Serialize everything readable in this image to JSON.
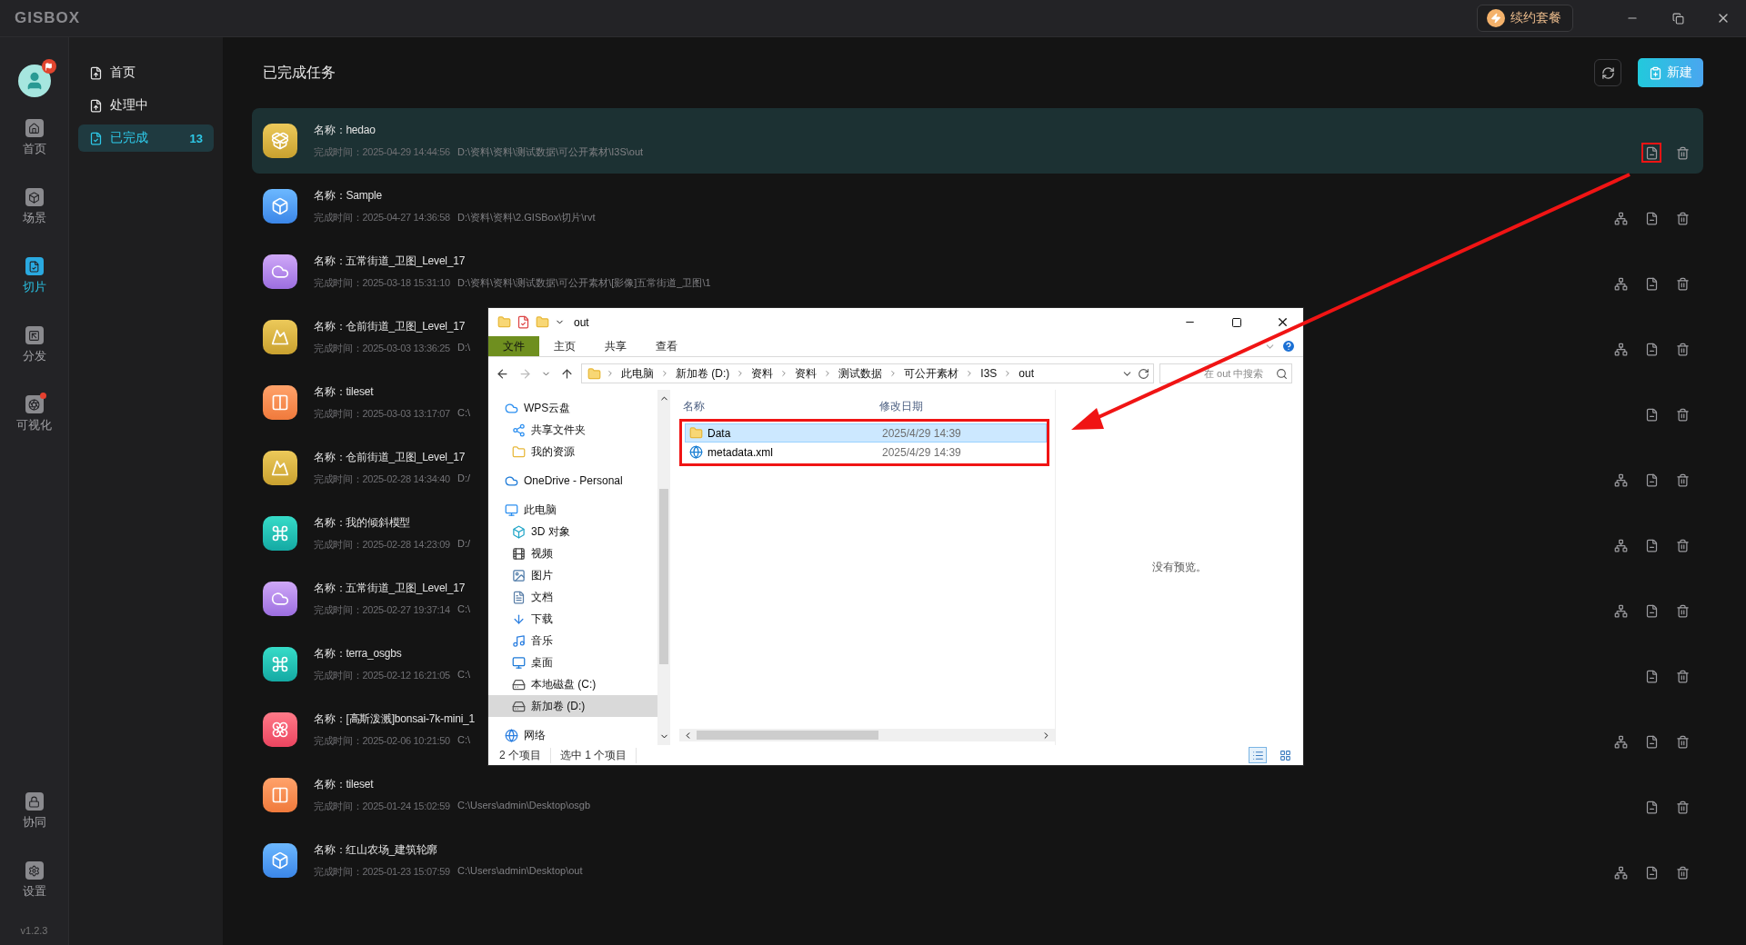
{
  "app": {
    "logo": "GISBOX",
    "plan_button": "续约套餐",
    "version": "v1.2.3"
  },
  "rail": [
    {
      "label": "首页",
      "kind": "home",
      "selected": false,
      "alert": false
    },
    {
      "label": "场景",
      "kind": "scene",
      "selected": false,
      "alert": false
    },
    {
      "label": "切片",
      "kind": "tile",
      "selected": true,
      "alert": false
    },
    {
      "label": "分发",
      "kind": "publish",
      "selected": false,
      "alert": false
    },
    {
      "label": "可视化",
      "kind": "visual",
      "selected": false,
      "alert": true
    }
  ],
  "rail_bottom": [
    {
      "label": "协同",
      "kind": "team"
    },
    {
      "label": "设置",
      "kind": "settings"
    }
  ],
  "subnav": [
    {
      "label": "首页",
      "kind": "upload",
      "selected": false
    },
    {
      "label": "处理中",
      "kind": "upload",
      "selected": false
    },
    {
      "label": "已完成",
      "kind": "done",
      "selected": true,
      "count": "13"
    }
  ],
  "page": {
    "title": "已完成任务",
    "new_button": "新建"
  },
  "tasks": [
    {
      "kind": "i3s",
      "name_label": "名称：",
      "name": "hedao",
      "time_label": "完成时间：",
      "time": "2025-04-29 14:44:56",
      "path": "D:\\资料\\资料\\测试数据\\可公开素材\\I3S\\out",
      "selected": true,
      "actions": [
        {
          "kind": "folder",
          "framed": true
        },
        {
          "kind": "delete",
          "framed": false
        }
      ]
    },
    {
      "kind": "model",
      "name_label": "名称：",
      "name": "Sample",
      "time_label": "完成时间：",
      "time": "2025-04-27 14:36:58",
      "path": "D:\\资料\\资料\\2.GISBox\\切片\\rvt",
      "selected": false,
      "actions": [
        {
          "kind": "publish",
          "framed": false
        },
        {
          "kind": "folder",
          "framed": false
        },
        {
          "kind": "delete",
          "framed": false
        }
      ]
    },
    {
      "kind": "imagery",
      "name_label": "名称：",
      "name": "五常街道_卫图_Level_17",
      "time_label": "完成时间：",
      "time": "2025-03-18 15:31:10",
      "path": "D:\\资料\\资料\\测试数据\\可公开素材\\[影像]五常街道_卫图\\1",
      "selected": false,
      "actions": [
        {
          "kind": "publish",
          "framed": false
        },
        {
          "kind": "folder",
          "framed": false
        },
        {
          "kind": "delete",
          "framed": false
        }
      ]
    },
    {
      "kind": "terrain",
      "name_label": "名称：",
      "name": "仓前街道_卫图_Level_17",
      "time_label": "完成时间：",
      "time": "2025-03-03 13:36:25",
      "path": "D:\\",
      "selected": false,
      "actions": [
        {
          "kind": "publish",
          "framed": false
        },
        {
          "kind": "folder",
          "framed": false
        },
        {
          "kind": "delete",
          "framed": false
        }
      ]
    },
    {
      "kind": "tileset",
      "name_label": "名称：",
      "name": "tileset",
      "time_label": "完成时间：",
      "time": "2025-03-03 13:17:07",
      "path": "C:\\",
      "selected": false,
      "actions": [
        {
          "kind": "folder",
          "framed": false
        },
        {
          "kind": "delete",
          "framed": false
        }
      ]
    },
    {
      "kind": "terrain",
      "name_label": "名称：",
      "name": "仓前街道_卫图_Level_17",
      "time_label": "完成时间：",
      "time": "2025-02-28 14:34:40",
      "path": "D:/",
      "selected": false,
      "actions": [
        {
          "kind": "publish",
          "framed": false
        },
        {
          "kind": "folder",
          "framed": false
        },
        {
          "kind": "delete",
          "framed": false
        }
      ]
    },
    {
      "kind": "osgb",
      "name_label": "名称：",
      "name": "我的倾斜模型",
      "time_label": "完成时间：",
      "time": "2025-02-28 14:23:09",
      "path": "D:/",
      "selected": false,
      "actions": [
        {
          "kind": "publish",
          "framed": false
        },
        {
          "kind": "folder",
          "framed": false
        },
        {
          "kind": "delete",
          "framed": false
        }
      ]
    },
    {
      "kind": "imagery",
      "name_label": "名称：",
      "name": "五常街道_卫图_Level_17",
      "time_label": "完成时间：",
      "time": "2025-02-27 19:37:14",
      "path": "C:\\",
      "selected": false,
      "actions": [
        {
          "kind": "publish",
          "framed": false
        },
        {
          "kind": "folder",
          "framed": false
        },
        {
          "kind": "delete",
          "framed": false
        }
      ]
    },
    {
      "kind": "osgb",
      "name_label": "名称：",
      "name": "terra_osgbs",
      "time_label": "完成时间：",
      "time": "2025-02-12 16:21:05",
      "path": "C:\\",
      "selected": false,
      "actions": [
        {
          "kind": "folder",
          "framed": false
        },
        {
          "kind": "delete",
          "framed": false
        }
      ]
    },
    {
      "kind": "splat",
      "name_label": "名称：",
      "name": "[高斯泼溅]bonsai-7k-mini_1",
      "time_label": "完成时间：",
      "time": "2025-02-06 10:21:50",
      "path": "C:\\",
      "selected": false,
      "actions": [
        {
          "kind": "publish",
          "framed": false
        },
        {
          "kind": "folder",
          "framed": false
        },
        {
          "kind": "delete",
          "framed": false
        }
      ]
    },
    {
      "kind": "tileset",
      "name_label": "名称：",
      "name": "tileset",
      "time_label": "完成时间：",
      "time": "2025-01-24 15:02:59",
      "path": "C:\\Users\\admin\\Desktop\\osgb",
      "selected": false,
      "actions": [
        {
          "kind": "folder",
          "framed": false
        },
        {
          "kind": "delete",
          "framed": false
        }
      ]
    },
    {
      "kind": "model",
      "name_label": "名称：",
      "name": "红山农场_建筑轮廓",
      "time_label": "完成时间：",
      "time": "2025-01-23 15:07:59",
      "path": "C:\\Users\\admin\\Desktop\\out",
      "selected": false,
      "actions": [
        {
          "kind": "publish",
          "framed": false
        },
        {
          "kind": "folder",
          "framed": false
        },
        {
          "kind": "delete",
          "framed": false
        }
      ]
    }
  ],
  "explorer": {
    "title": "out",
    "ribbon_tabs": [
      {
        "label": "文件",
        "selected": true
      },
      {
        "label": "主页",
        "selected": false
      },
      {
        "label": "共享",
        "selected": false
      },
      {
        "label": "查看",
        "selected": false
      }
    ],
    "breadcrumb": [
      "此电脑",
      "新加卷 (D:)",
      "资料",
      "资料",
      "测试数据",
      "可公开素材",
      "I3S",
      "out"
    ],
    "search": {
      "placeholder": "在 out 中搜索"
    },
    "nav": [
      {
        "label": "WPS云盘",
        "kind": "cloud",
        "selected": false,
        "children": [
          {
            "label": "共享文件夹",
            "kind": "share",
            "selected": false
          },
          {
            "label": "我的资源",
            "kind": "folder",
            "selected": false
          }
        ]
      },
      {
        "label": "OneDrive - Personal",
        "kind": "onedrive",
        "selected": false
      },
      {
        "label": "此电脑",
        "kind": "pc",
        "selected": false,
        "children": [
          {
            "label": "3D 对象",
            "kind": "objects",
            "selected": false
          },
          {
            "label": "视频",
            "kind": "video",
            "selected": false
          },
          {
            "label": "图片",
            "kind": "pictures",
            "selected": false
          },
          {
            "label": "文档",
            "kind": "docs",
            "selected": false
          },
          {
            "label": "下载",
            "kind": "downloads",
            "selected": false
          },
          {
            "label": "音乐",
            "kind": "music",
            "selected": false
          },
          {
            "label": "桌面",
            "kind": "desktop",
            "selected": false
          },
          {
            "label": "本地磁盘 (C:)",
            "kind": "drive",
            "selected": false
          },
          {
            "label": "新加卷 (D:)",
            "kind": "drive",
            "selected": true
          }
        ]
      },
      {
        "label": "网络",
        "kind": "network",
        "selected": false
      }
    ],
    "columns": [
      "名称",
      "修改日期"
    ],
    "files_framed": true,
    "files": [
      {
        "name": "Data",
        "kind": "folder",
        "modified": "2025/4/29 14:39",
        "selected": true
      },
      {
        "name": "metadata.xml",
        "kind": "xml",
        "modified": "2025/4/29 14:39",
        "selected": false
      }
    ],
    "preview": "没有预览。",
    "status": [
      "2 个项目",
      "选中 1 个项目"
    ]
  }
}
